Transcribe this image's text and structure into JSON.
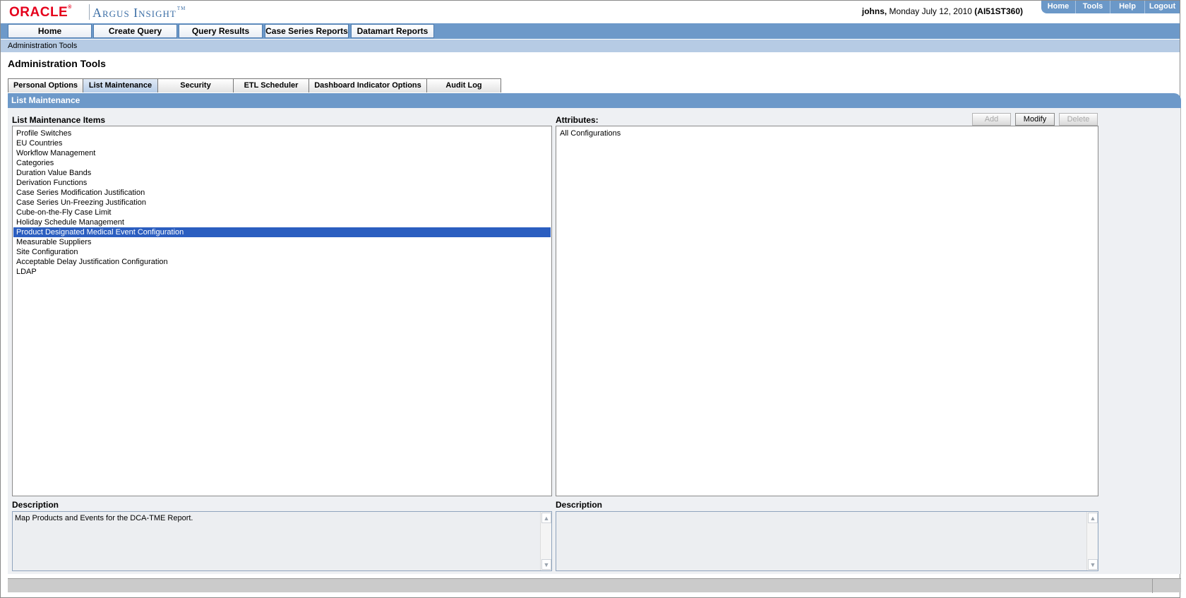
{
  "header": {
    "logo_oracle": "ORACLE",
    "logo_product": "Argus Insight",
    "user": "johns,",
    "date": " Monday July 12, 2010 ",
    "server": "(AI51ST360)",
    "top_nav": [
      "Home",
      "Tools",
      "Help",
      "Logout"
    ]
  },
  "main_nav": [
    "Home",
    "Create Query",
    "Query Results",
    "Case Series Reports",
    "Datamart Reports"
  ],
  "breadcrumb": "Administration Tools",
  "page_title": "Administration Tools",
  "tabs": [
    {
      "label": "Personal Options",
      "active": false
    },
    {
      "label": "List Maintenance",
      "active": true
    },
    {
      "label": "Security",
      "active": false
    },
    {
      "label": "ETL Scheduler",
      "active": false
    },
    {
      "label": "Dashboard Indicator Options",
      "active": false
    },
    {
      "label": "Audit Log",
      "active": false
    }
  ],
  "panel": {
    "title": "List Maintenance",
    "list_label": "List Maintenance Items",
    "list_items": [
      "Profile Switches",
      "EU Countries",
      "Workflow Management",
      "Categories",
      "Duration Value Bands",
      "Derivation Functions",
      "Case Series Modification Justification",
      "Case Series Un-Freezing Justification",
      "Cube-on-the-Fly Case Limit",
      "Holiday Schedule Management",
      "Product Designated Medical Event Configuration",
      "Measurable Suppliers",
      "Site Configuration",
      "Acceptable Delay Justification Configuration",
      "LDAP"
    ],
    "selected_index": 10,
    "attributes_label": "Attributes:",
    "attributes": [
      "All Configurations"
    ],
    "buttons": {
      "add": "Add",
      "modify": "Modify",
      "delete": "Delete"
    },
    "description_label": "Description",
    "description_left": "Map Products and Events for the DCA-TME Report.",
    "description_right_label": "Description",
    "description_right": ""
  },
  "colors": {
    "nav_blue": "#6d99c9",
    "selection": "#2b5ec0",
    "oracle_red": "#e5001c"
  }
}
